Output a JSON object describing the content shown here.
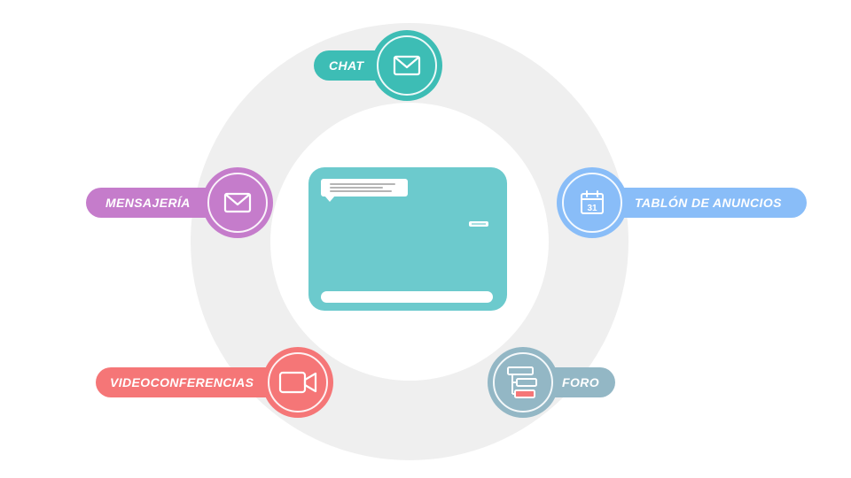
{
  "colors": {
    "ring": "#efefef",
    "hub": "#6ccacd",
    "chat": "#3dbdb5",
    "mensajeria": "#c57ccb",
    "tablon": "#89bdf8",
    "videoconferencias": "#f57677",
    "foro": "#93b7c5"
  },
  "nodes": {
    "chat": {
      "label": "CHAT",
      "icon": "envelope-icon"
    },
    "mensajeria": {
      "label": "MENSAJERÍA",
      "icon": "envelope-icon"
    },
    "tablon": {
      "label": "TABLÓN DE ANUNCIOS",
      "icon": "calendar-icon",
      "icon_text": "31"
    },
    "videoconferencias": {
      "label": "VIDEOCONFERENCIAS",
      "icon": "video-camera-icon"
    },
    "foro": {
      "label": "FORO",
      "icon": "forum-threads-icon"
    }
  }
}
